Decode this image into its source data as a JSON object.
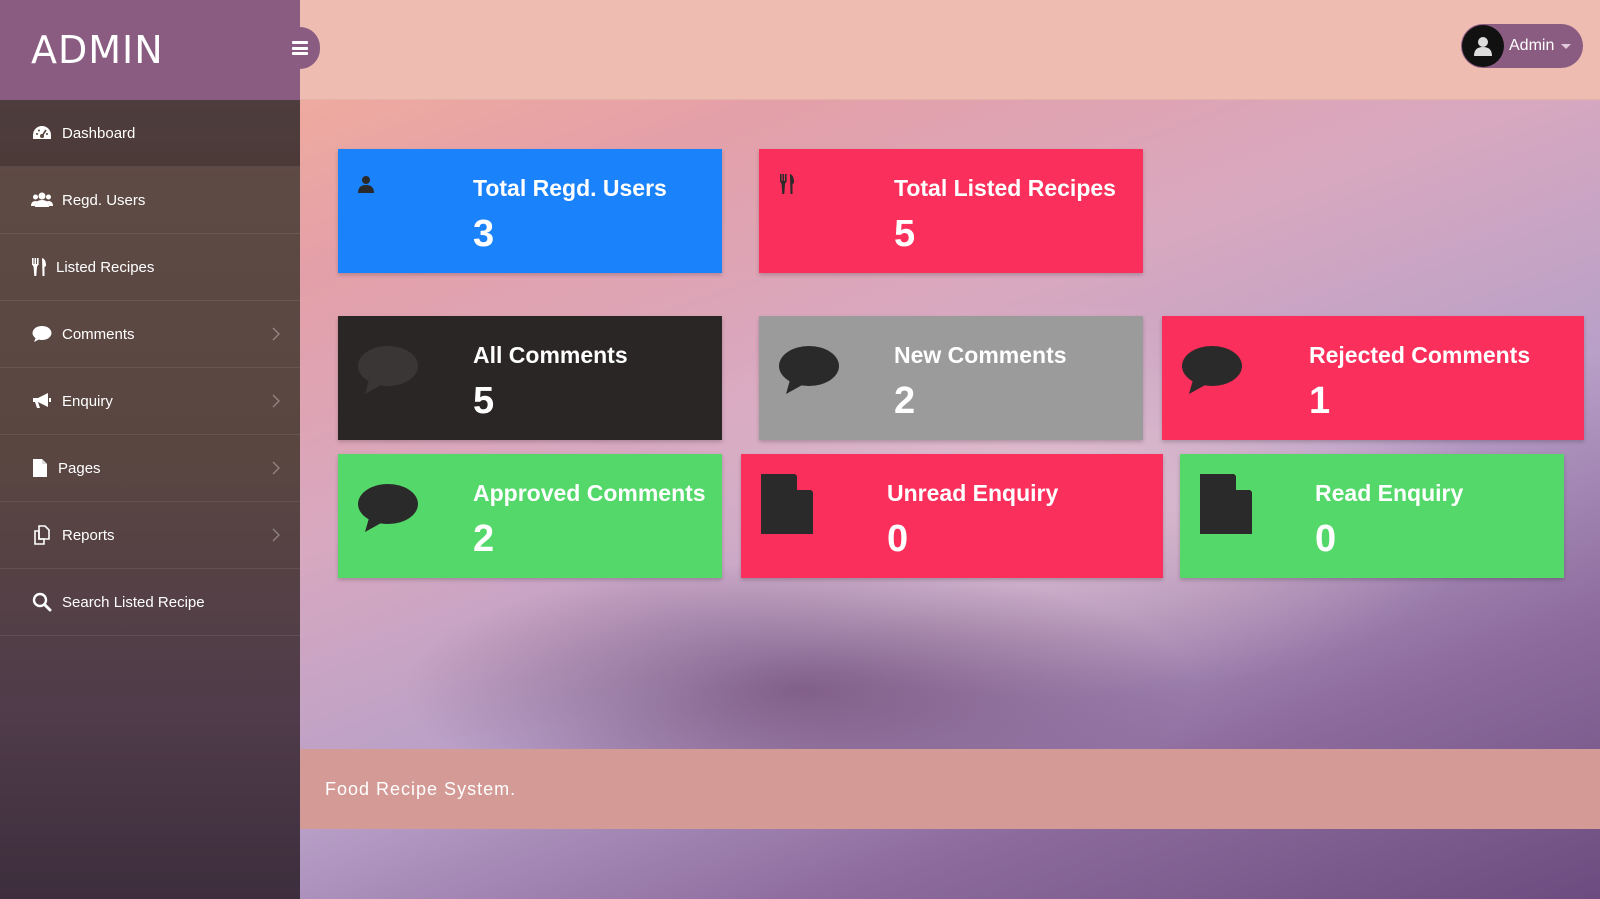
{
  "brand": {
    "title": "ADMIN"
  },
  "user": {
    "name": "Admin"
  },
  "sidebar": {
    "items": [
      {
        "label": "Dashboard",
        "icon": "dashboard-icon"
      },
      {
        "label": "Regd. Users",
        "icon": "users-icon"
      },
      {
        "label": "Listed Recipes",
        "icon": "cutlery-icon"
      },
      {
        "label": "Comments",
        "icon": "comment-icon"
      },
      {
        "label": "Enquiry",
        "icon": "bullhorn-icon"
      },
      {
        "label": "Pages",
        "icon": "file-icon"
      },
      {
        "label": "Reports",
        "icon": "copy-icon"
      },
      {
        "label": "Search Listed Recipe",
        "icon": "search-icon"
      }
    ]
  },
  "cards": {
    "total_users": {
      "title": "Total Regd. Users",
      "value": "3",
      "color": "#1a82fb"
    },
    "total_recipes": {
      "title": "Total Listed Recipes",
      "value": "5",
      "color": "#fb2f5b"
    },
    "all_comments": {
      "title": "All Comments",
      "value": "5",
      "color": "#2a2626"
    },
    "new_comments": {
      "title": "New Comments",
      "value": "2",
      "color": "#9b9b9b"
    },
    "rejected_comments": {
      "title": "Rejected Comments",
      "value": "1",
      "color": "#fb2f5b"
    },
    "approved_comments": {
      "title": "Approved Comments",
      "value": "2",
      "color": "#54d86a"
    },
    "unread_enquiry": {
      "title": "Unread Enquiry",
      "value": "0",
      "color": "#fb2f5b"
    },
    "read_enquiry": {
      "title": "Read Enquiry",
      "value": "0",
      "color": "#54d86a"
    }
  },
  "footer": {
    "text": "Food Recipe System."
  }
}
